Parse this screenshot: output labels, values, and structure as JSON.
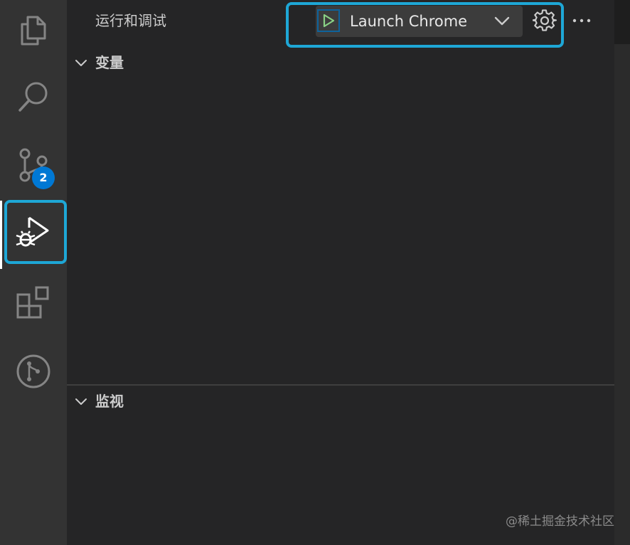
{
  "activity_bar": {
    "items": [
      {
        "name": "explorer",
        "icon": "files-icon"
      },
      {
        "name": "search",
        "icon": "search-icon"
      },
      {
        "name": "source-control",
        "icon": "source-control-icon",
        "badge": "2"
      },
      {
        "name": "run-and-debug",
        "icon": "run-debug-icon",
        "active": true
      },
      {
        "name": "extensions",
        "icon": "extensions-icon"
      },
      {
        "name": "git-graph",
        "icon": "git-branch-circle-icon"
      }
    ]
  },
  "sidebar": {
    "title": "运行和调试",
    "launch_config": {
      "label": "Launch Chrome",
      "play_icon": "play-icon",
      "dropdown_icon": "chevron-down-icon"
    },
    "actions": {
      "settings_icon": "gear-icon",
      "more_icon": "ellipsis-icon"
    },
    "sections": [
      {
        "label": "变量",
        "expanded": true
      },
      {
        "label": "监视",
        "expanded": true
      }
    ]
  },
  "watermark": "@稀土掘金技术社区",
  "colors": {
    "activity_bar_bg": "#333333",
    "sidebar_bg": "#252526",
    "highlight": "#1ea7d6",
    "badge": "#0078d4",
    "play_green": "#89d185"
  }
}
